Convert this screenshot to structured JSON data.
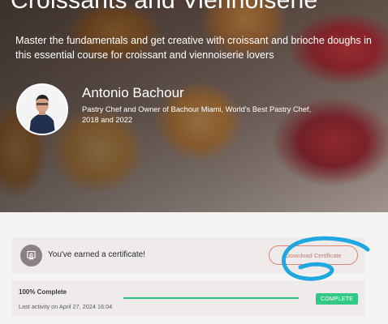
{
  "course": {
    "title": "Croissants and Viennoiserie",
    "description": "Master the fundamentals and get creative with croissant and brioche doughs in this essential course for croissant and viennoiserie lovers"
  },
  "instructor": {
    "name": "Antonio Bachour",
    "bio": "Pastry Chef and Owner of Bachour Miami, World's Best Pastry Chef, 2018 and 2022"
  },
  "certificate": {
    "message": "You've earned a certificate!",
    "download_label": "Download Certificate",
    "icon": "certificate-icon"
  },
  "progress": {
    "percent": 100,
    "label": "100% Complete",
    "last_activity": "Last activity on April 27, 2024 16:04",
    "status": "COMPLETE"
  },
  "colors": {
    "accent": "#e08274",
    "complete_green": "#31c985",
    "scribble": "#1ea7e1"
  }
}
